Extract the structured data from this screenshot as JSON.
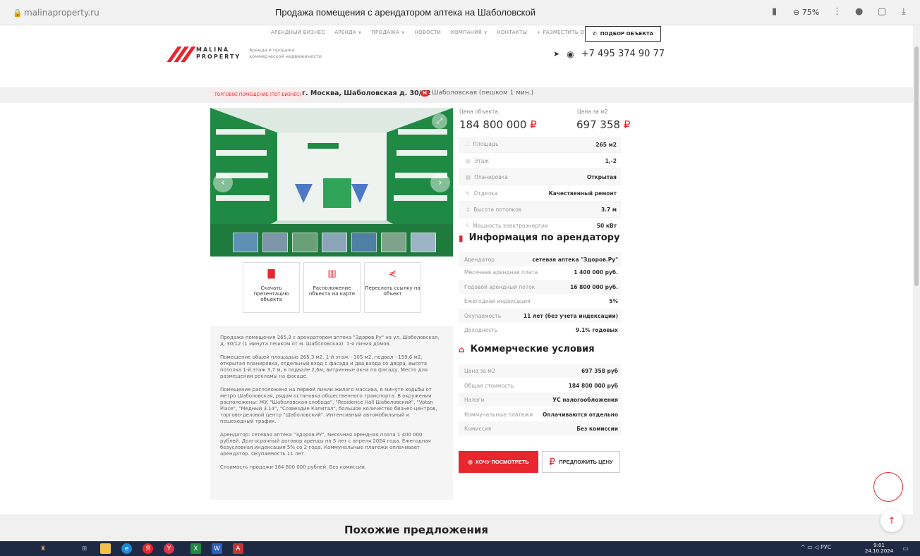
{
  "browser": {
    "url": "malinaproperty.ru",
    "title": "Продажа помещения с арендатором аптека на Шаболовской",
    "zoom": "75%"
  },
  "topnav": [
    "АРЕНДНЫЙ БИЗНЕС",
    "АРЕНДА ∨",
    "ПРОДАЖА ∨",
    "НОВОСТИ",
    "КОМПАНИЯ ∨",
    "КОНТАКТЫ",
    "+ РАЗМЕСТИТЬ ОБЪЯВЛЕНИЕ"
  ],
  "pick_button": "ПОДБОР ОБЪЕКТА",
  "logo": {
    "line1": "MALINA",
    "line2": "PROPERTY",
    "subtitle": "Аренда и продажа коммерческой недвижимости"
  },
  "phone": "+7 495 374 90 77",
  "address": {
    "tag": "ТОРГОВОЕ ПОМЕЩЕНИЕ (ПОТ БИЗНЕС)",
    "main": "г. Москва, Шаболовская д. 30/12",
    "metro_badge": "М",
    "metro": "Шаболовская (пешком 1 мин.)"
  },
  "actions": [
    {
      "icon": "file-icon",
      "label": "Скачать презентацию объекта"
    },
    {
      "icon": "map-icon",
      "label": "Расположение объекта на карте"
    },
    {
      "icon": "share-icon",
      "label": "Переслать ссылку на объект"
    }
  ],
  "description": [
    "Продажа помещения 265,3 с арендатором аптека \"Здоров.Ру\" на ул. Шаболовская, д. 30/12 (1 минута пешком от м. Шаболовская). 1-я линия домов.",
    "Помещение общей площадью 265,3 м2, 1-й этаж - 105 м2, подвал - 159,6 м2, открытая планировка, отдельный вход с фасада и два входа со двора, высота потолка 1-й этаж 3,7 м, в подвале 2,6м, витринные окна по фасаду. Место для размещения рекламы на фасаде.",
    "Помещение расположено на первой линии жилого массива, в минуте ходьбы от метро Шаболовская, рядом остановка общественного транспорта. В окружении расположены: ЖК \"Шаболовская слобода\", \"Residence Hall Шаболовский\", \"Votan Place\", \"Медный 3.14\", \"Созвездие Капитал\", большое количество бизнес-центров, торгово-деловой центр \"Шаболовский\". Интенсивный автомобильный и пешеходный трафик.",
    "Арендатор: сетевая аптека \"Здоров.РУ\", месячная арендная плата 1 400 000 рублей. Долгосрочный договор аренды на 5 лет с апреля 2024 года. Ежегодная безусловная индексация 5% со 2-года. Коммунальные платежи оплачивает арендатор. Окупаемость 11 лет.",
    "Стоимость продажи 184 800 000 рублей. Без комиссии."
  ],
  "price": {
    "object_label": "Цена объекта",
    "object_value": "184 800 000",
    "sqm_label": "Цена за м2",
    "sqm_value": "697 358",
    "currency": "₽"
  },
  "specs": [
    {
      "icon": "area-icon",
      "glyph": "⛶",
      "label": "Площадь",
      "value": "265 м2"
    },
    {
      "icon": "floor-icon",
      "glyph": "▤",
      "label": "Этаж",
      "value": "1,-2"
    },
    {
      "icon": "layout-icon",
      "glyph": "▦",
      "label": "Планировка",
      "value": "Открытая"
    },
    {
      "icon": "brush-icon",
      "glyph": "✎",
      "label": "Отделка",
      "value": "Качественный ремонт"
    },
    {
      "icon": "height-icon",
      "glyph": "↕",
      "label": "Высота потолков",
      "value": "3.7 м"
    },
    {
      "icon": "power-icon",
      "glyph": "ϟ",
      "label": "Мощность электроэнергии",
      "value": "50 кВт"
    }
  ],
  "tenant_title": "Информация по арендатору",
  "tenant": [
    {
      "label": "Арендатор",
      "value": "сетевая аптека \"Здоров.Ру\""
    },
    {
      "label": "Месячная арендная плата",
      "value": "1 400 000 руб."
    },
    {
      "label": "Годовой арендный поток",
      "value": "16 800 000 руб."
    },
    {
      "label": "Ежегодная индексация",
      "value": "5%"
    },
    {
      "label": "Окупаемость",
      "value": "11 лет (без учета индексации)"
    },
    {
      "label": "Доходность",
      "value": "9.1% годовых"
    }
  ],
  "commercial_title": "Коммерческие условия",
  "commercial": [
    {
      "label": "Цена за м2",
      "value": "697 358 руб"
    },
    {
      "label": "Общая стоимость",
      "value": "184 800 000 руб"
    },
    {
      "label": "Налоги",
      "value": "УС налогообложения"
    },
    {
      "label": "Коммунальные платежи",
      "value": "Оплачиваются отдельно"
    },
    {
      "label": "Комиссия",
      "value": "Без комиссии"
    }
  ],
  "buttons": {
    "want": "ХОЧУ ПОСМОТРЕТЬ",
    "offer": "ПРЕДЛОЖИТЬ ЦЕНУ"
  },
  "similar_title": "Похожие предложения",
  "taskbar": {
    "lang": "РУС",
    "time": "9:01",
    "date": "24.10.2024"
  },
  "colors": {
    "accent": "#e8262d",
    "taskbar": "#1e2a44"
  }
}
